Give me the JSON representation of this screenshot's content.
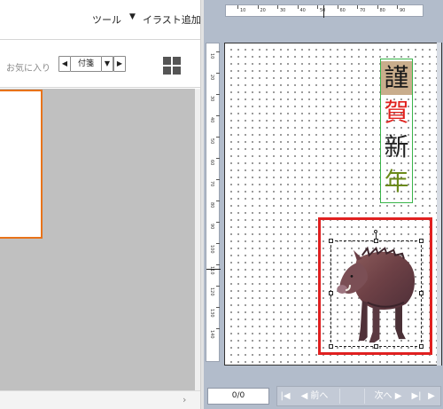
{
  "toolbar": {
    "tools_label": "ツール",
    "dropdown_arrow": "▼",
    "add_illust_label": "イラスト追加"
  },
  "filter": {
    "favorites_label": "お気に入り",
    "prev_arrow": "◀",
    "category_value": "付箋",
    "dropdown_arrow": "▼",
    "next_arrow": "▶"
  },
  "ruler": {
    "h_ticks": [
      "10",
      "20",
      "30",
      "40",
      "50",
      "60",
      "70",
      "80",
      "90"
    ],
    "v_ticks": [
      "10",
      "20",
      "30",
      "40",
      "50",
      "60",
      "70",
      "80",
      "90",
      "100",
      "110",
      "120",
      "130",
      "140"
    ]
  },
  "greeting": {
    "chars": [
      "謹",
      "賀",
      "新",
      "年"
    ],
    "colors": [
      "#1a1a1a",
      "#e0201c",
      "#222222",
      "#6b8a1a"
    ],
    "highlight_bg": "#c9ad8c",
    "frame_color": "#39b54a"
  },
  "illustration": {
    "icon": "wild-boar-illustration",
    "highlight_color": "#e02020"
  },
  "pager": {
    "page_counter": "0/0",
    "first_label": "|◀",
    "prev_label": "◀ 前へ",
    "next_label": "次へ ▶",
    "last_label": "▶|",
    "end_label": "▶"
  },
  "left_panel": {
    "preview_border_color": "#e8731a",
    "scroll_arrow": "›"
  }
}
